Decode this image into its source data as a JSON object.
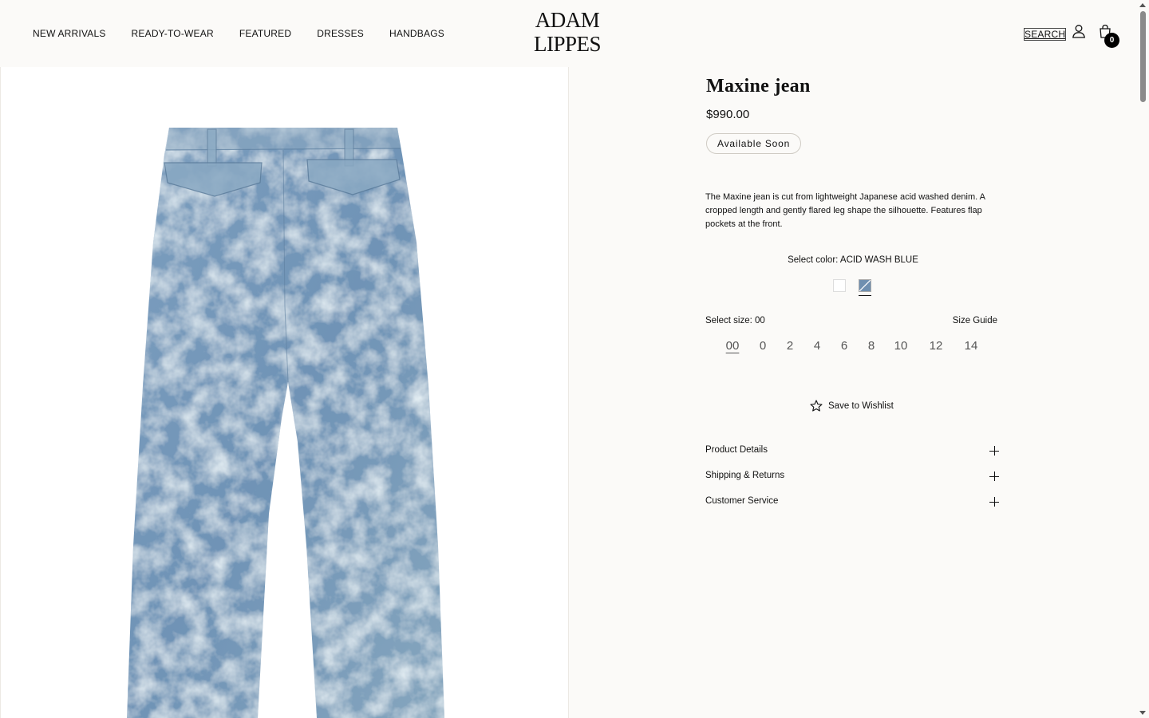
{
  "header": {
    "nav": [
      "NEW ARRIVALS",
      "READY-TO-WEAR",
      "FEATURED",
      "DRESSES",
      "HANDBAGS"
    ],
    "logo_line1": "ADAM",
    "logo_line2": "LIPPES",
    "search_label": "SEARCH",
    "cart_count": "0"
  },
  "product": {
    "title": "Maxine jean",
    "price": "$990.00",
    "badge": "Available Soon",
    "description": "The Maxine jean is cut from lightweight Japanese acid washed denim. A cropped length and gently flared leg shape the silhouette. Features flap pockets at the front.",
    "color_label": "Select color: ACID WASH BLUE",
    "swatch_colors": [
      "#ffffff",
      "#6f8fb0"
    ],
    "size_label": "Select size: 00",
    "size_guide": "Size Guide",
    "sizes": [
      "00",
      "0",
      "2",
      "4",
      "6",
      "8",
      "10",
      "12",
      "14"
    ],
    "selected_size": "00",
    "wishlist": "Save to Wishlist",
    "accordions": [
      "Product Details",
      "Shipping & Returns",
      "Customer Service"
    ]
  }
}
